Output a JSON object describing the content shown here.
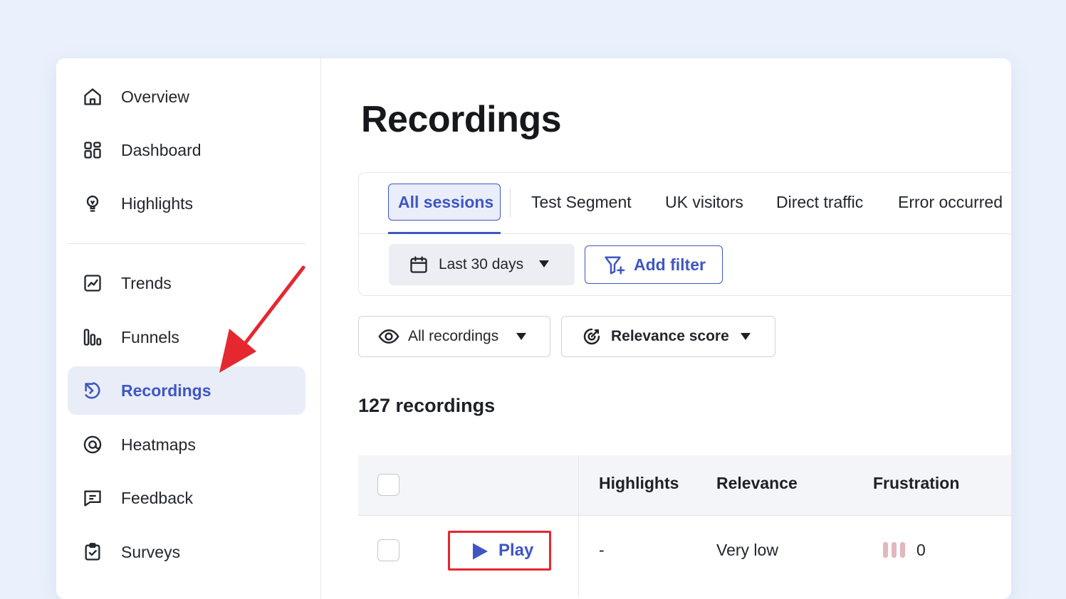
{
  "sidebar": {
    "items": [
      {
        "label": "Overview",
        "icon": "home-icon"
      },
      {
        "label": "Dashboard",
        "icon": "dashboard-grid-icon"
      },
      {
        "label": "Highlights",
        "icon": "lightbulb-icon"
      },
      {
        "label": "Trends",
        "icon": "trend-chart-icon"
      },
      {
        "label": "Funnels",
        "icon": "funnel-bars-icon"
      },
      {
        "label": "Recordings",
        "icon": "recording-replay-icon",
        "active": true
      },
      {
        "label": "Heatmaps",
        "icon": "heatmap-target-icon"
      },
      {
        "label": "Feedback",
        "icon": "feedback-message-icon"
      },
      {
        "label": "Surveys",
        "icon": "survey-clipboard-icon"
      }
    ]
  },
  "main": {
    "title": "Recordings",
    "tabs": [
      {
        "label": "All sessions",
        "active": true
      },
      {
        "label": "Test Segment"
      },
      {
        "label": "UK visitors"
      },
      {
        "label": "Direct traffic"
      },
      {
        "label": "Error occurred"
      }
    ],
    "date_filter": {
      "label": "Last 30 days",
      "icon": "calendar-icon"
    },
    "add_filter": {
      "label": "Add filter",
      "icon": "filter-plus-icon"
    },
    "recordings_dropdown": {
      "label": "All recordings",
      "icon": "eye-icon"
    },
    "sort_dropdown": {
      "label": "Relevance score",
      "icon": "relevance-score-icon"
    },
    "count_text": "127 recordings",
    "table": {
      "columns": [
        "Highlights",
        "Relevance",
        "Frustration"
      ],
      "rows": [
        {
          "play_label": "Play",
          "highlights": "-",
          "relevance": "Very low",
          "frustration": "0"
        }
      ]
    }
  },
  "colors": {
    "accent": "#3f56c4",
    "active_bg": "#e9edf8",
    "annotation_red": "#e5272f",
    "frustration_bar": "#e3b7bc",
    "page_bg": "#eaf1fc"
  }
}
